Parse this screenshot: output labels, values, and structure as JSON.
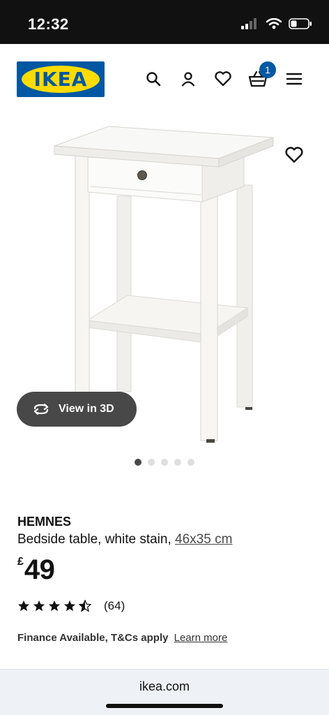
{
  "status_bar": {
    "time": "12:32"
  },
  "header": {
    "logo_text": "IKEA",
    "cart_count": "1",
    "icons": [
      "search-icon",
      "account-icon",
      "heart-icon",
      "basket-icon",
      "menu-icon"
    ]
  },
  "gallery": {
    "view3d_label": "View in 3D",
    "image_count": 5,
    "active_index": 0
  },
  "product": {
    "name": "HEMNES",
    "description": "Bedside table, white stain,",
    "dimensions": "46x35 cm",
    "currency": "£",
    "price": "49",
    "rating": 4.5,
    "rating_max": 5,
    "review_count": "(64)"
  },
  "finance": {
    "text": "Finance Available, T&Cs apply",
    "link": "Learn more"
  },
  "browser": {
    "url": "ikea.com"
  },
  "colors": {
    "ikea_blue": "#0058a3",
    "ikea_yellow": "#ffdb00",
    "pill_dark": "#484848"
  }
}
